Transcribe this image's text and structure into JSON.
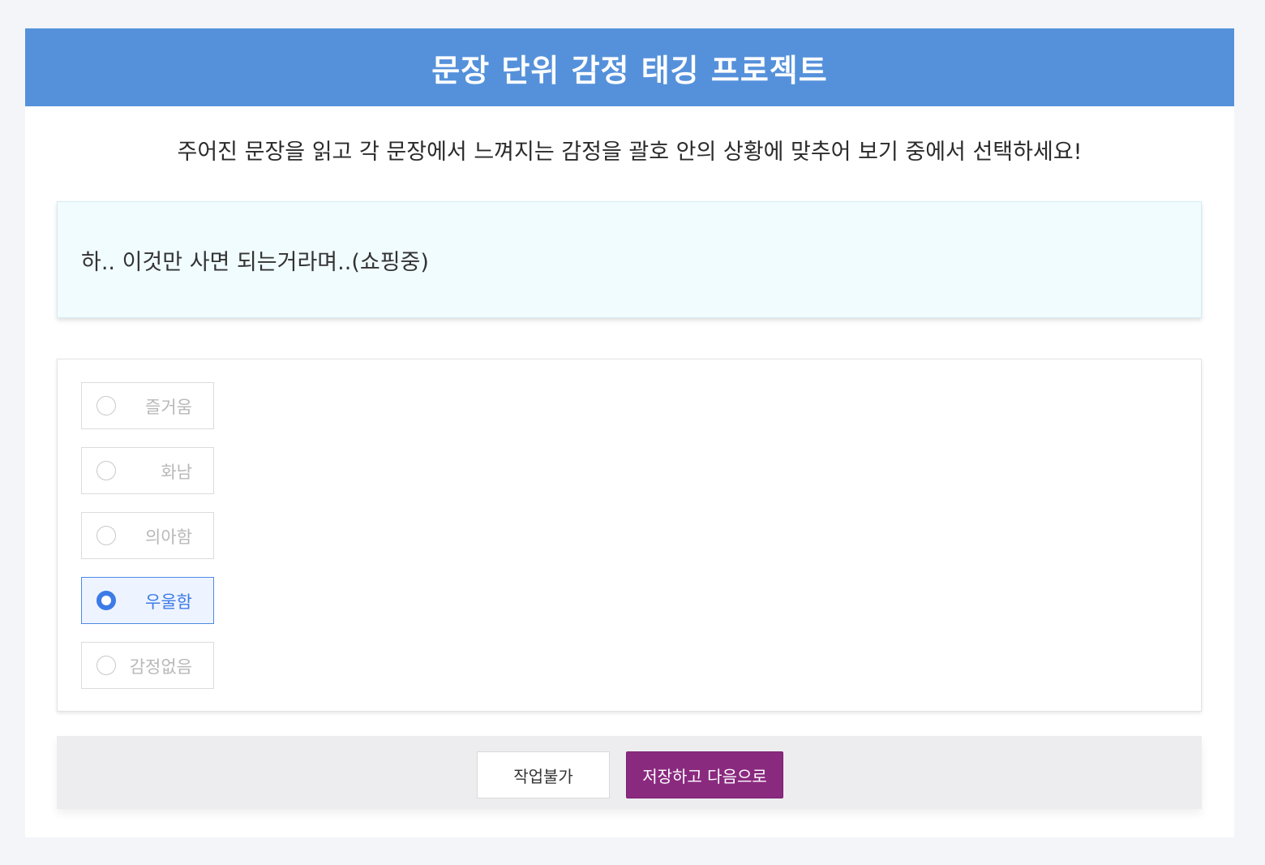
{
  "header": {
    "title": "문장 단위 감정 태깅 프로젝트"
  },
  "instruction": "주어진 문장을 읽고 각 문장에서 느껴지는 감정을 괄호 안의 상황에 맞추어 보기 중에서 선택하세요!",
  "sentence": "하.. 이것만 사면 되는거라며..(쇼핑중)",
  "options": [
    {
      "label": "즐거움",
      "selected": false
    },
    {
      "label": "화남",
      "selected": false
    },
    {
      "label": "의아함",
      "selected": false
    },
    {
      "label": "우울함",
      "selected": true
    },
    {
      "label": "감정없음",
      "selected": false
    }
  ],
  "buttons": {
    "skip_label": "작업불가",
    "save_label": "저장하고 다음으로"
  },
  "colors": {
    "header_bg": "#5591db",
    "sentence_bg": "#f1fcff",
    "selected_accent": "#3d7be6",
    "save_button_bg": "#8a2a7f"
  }
}
